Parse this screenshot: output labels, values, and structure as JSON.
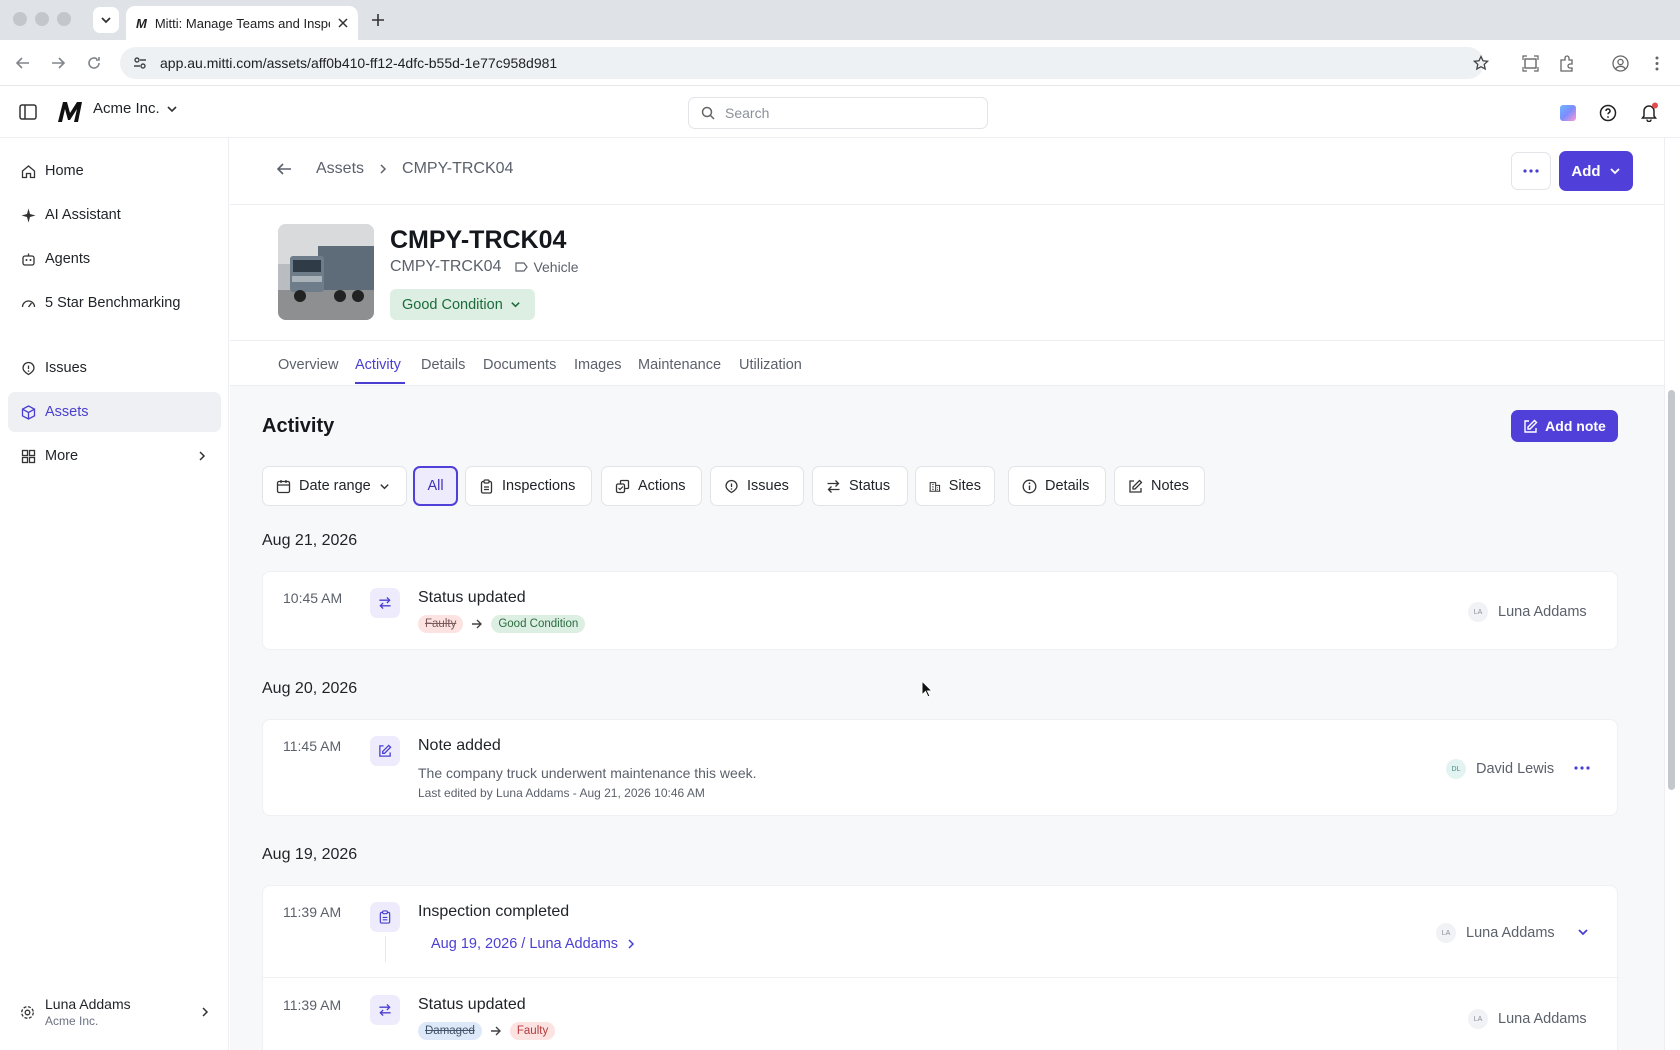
{
  "browser": {
    "tab_title": "Mitti: Manage Teams and Inspections",
    "tab_logo": "M",
    "url": "app.au.mitti.com/assets/aff0b410-ff12-4dfc-b55d-1e77c958d981"
  },
  "header": {
    "org_name": "Acme Inc.",
    "search_placeholder": "Search"
  },
  "sidebar": {
    "items": [
      {
        "label": "Home",
        "icon": "home-icon"
      },
      {
        "label": "AI Assistant",
        "icon": "sparkle-icon"
      },
      {
        "label": "Agents",
        "icon": "robot-icon"
      },
      {
        "label": "5 Star Benchmarking",
        "icon": "gauge-icon"
      },
      {
        "label": "Issues",
        "icon": "issue-icon"
      },
      {
        "label": "Assets",
        "icon": "cube-icon",
        "active": true
      },
      {
        "label": "More",
        "icon": "grid-icon"
      }
    ],
    "user": {
      "name": "Luna Addams",
      "org": "Acme Inc."
    }
  },
  "breadcrumb": {
    "parent": "Assets",
    "current": "CMPY-TRCK04"
  },
  "actions": {
    "add_label": "Add"
  },
  "asset": {
    "title": "CMPY-TRCK04",
    "code": "CMPY-TRCK04",
    "type": "Vehicle",
    "condition": "Good Condition"
  },
  "tabs": [
    "Overview",
    "Activity",
    "Details",
    "Documents",
    "Images",
    "Maintenance",
    "Utilization"
  ],
  "activity": {
    "title": "Activity",
    "add_note_label": "Add note",
    "filters": [
      "Date range",
      "All",
      "Inspections",
      "Actions",
      "Issues",
      "Status",
      "Sites",
      "Details",
      "Notes"
    ],
    "groups": [
      {
        "date": "Aug 21, 2026",
        "events": [
          {
            "time": "10:45 AM",
            "title": "Status updated",
            "from": "Faulty",
            "to": "Good Condition",
            "user": "Luna Addams",
            "initials": "LA"
          }
        ]
      },
      {
        "date": "Aug 20, 2026",
        "events": [
          {
            "time": "11:45 AM",
            "title": "Note added",
            "text": "The company truck underwent maintenance this week.",
            "meta": "Last edited by Luna Addams - Aug 21, 2026 10:46 AM",
            "user": "David Lewis",
            "initials": "DL"
          }
        ]
      },
      {
        "date": "Aug 19, 2026",
        "events": [
          {
            "time": "11:39 AM",
            "title": "Inspection completed",
            "link": "Aug 19, 2026 / Luna Addams",
            "user": "Luna Addams",
            "initials": "LA"
          },
          {
            "time": "11:39 AM",
            "title": "Status updated",
            "from": "Damaged",
            "to": "Faulty",
            "user": "Luna Addams",
            "initials": "LA"
          }
        ]
      }
    ]
  },
  "colors": {
    "accent": "#5040d9",
    "good": "#dcefe2",
    "faulty": "#fde2e2"
  }
}
